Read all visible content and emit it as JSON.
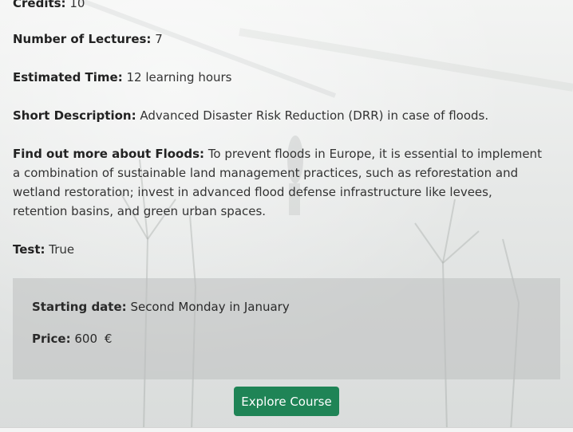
{
  "course": {
    "credits": {
      "label": "Credits:",
      "value": "10"
    },
    "lectures": {
      "label": "Number of Lectures:",
      "value": "7"
    },
    "time": {
      "label": "Estimated Time:",
      "value": "12 learning hours"
    },
    "short_description": {
      "label": "Short Description:",
      "value": "Advanced Disaster Risk Reduction (DRR) in case of floods."
    },
    "more_about": {
      "label": "Find out more about Floods:",
      "value": "To prevent floods in Europe, it is essential to implement a combination of sustainable land management practices, such as reforestation and wetland restoration; invest in advanced flood defense infrastructure like levees, retention basins, and green urban spaces."
    },
    "test": {
      "label": "Test:",
      "value": "True"
    }
  },
  "panel": {
    "starting_date": {
      "label": "Starting date:",
      "value": "Second Monday in January"
    },
    "price": {
      "label": "Price:",
      "value": "600",
      "currency": "€"
    }
  },
  "cta": {
    "label": "Explore Course",
    "color": "#1f8456"
  }
}
